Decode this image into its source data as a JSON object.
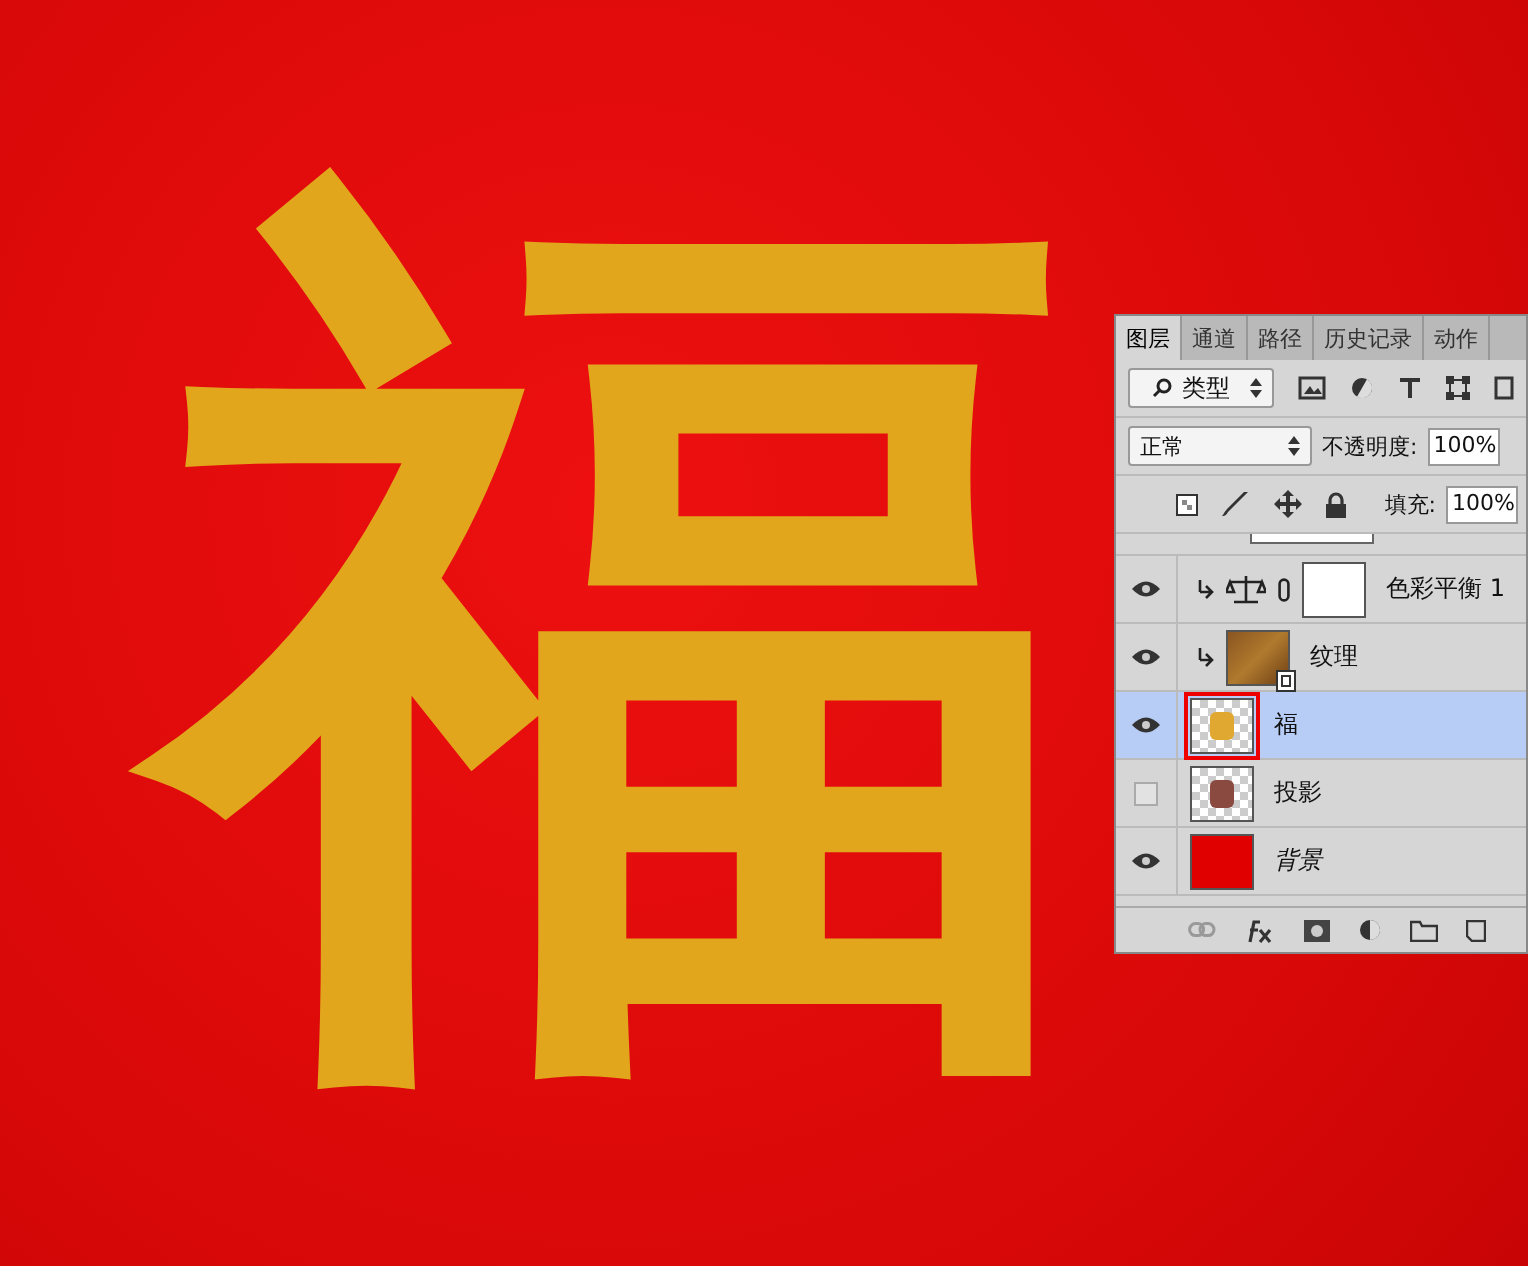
{
  "canvas": {
    "artwork_text": "福"
  },
  "layers_panel": {
    "tabs": [
      {
        "label": "图层",
        "selected": true
      },
      {
        "label": "通道",
        "selected": false
      },
      {
        "label": "路径",
        "selected": false
      },
      {
        "label": "历史记录",
        "selected": false
      },
      {
        "label": "动作",
        "selected": false
      }
    ],
    "filter": {
      "value": "类型"
    },
    "blend_mode": {
      "value": "正常"
    },
    "opacity": {
      "label": "不透明度:",
      "value": "100%"
    },
    "fill": {
      "label": "填充:",
      "value": "100%"
    },
    "layers": [
      {
        "name": "色彩平衡 1",
        "kind": "adjustment",
        "visible": true,
        "selected": false,
        "clipped": true,
        "italic": false
      },
      {
        "name": "纹理",
        "kind": "texture",
        "visible": true,
        "selected": false,
        "clipped": true,
        "italic": false
      },
      {
        "name": "福",
        "kind": "glyph",
        "visible": true,
        "selected": true,
        "clipped": false,
        "italic": false
      },
      {
        "name": "投影",
        "kind": "shadow",
        "visible": false,
        "selected": false,
        "clipped": false,
        "italic": false
      },
      {
        "name": "背景",
        "kind": "fill",
        "visible": true,
        "selected": false,
        "clipped": false,
        "italic": true
      }
    ]
  }
}
